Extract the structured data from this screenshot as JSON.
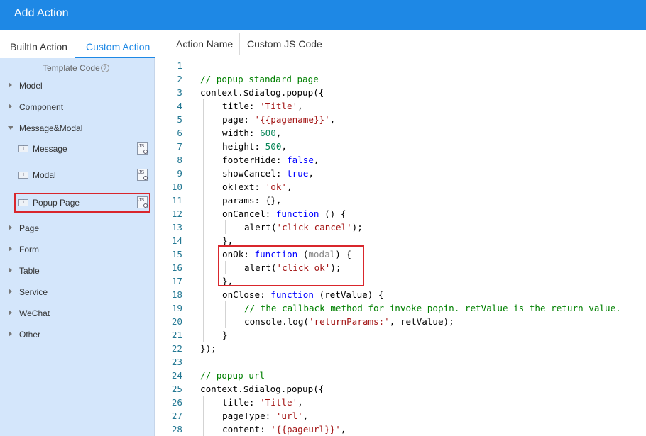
{
  "window": {
    "title": "Add Action"
  },
  "sidebar": {
    "tabs": [
      {
        "label": "BuiltIn Action",
        "active": false
      },
      {
        "label": "Custom Action",
        "active": true
      }
    ],
    "template_label": "Template Code",
    "tree": [
      {
        "label": "Model",
        "expanded": false
      },
      {
        "label": "Component",
        "expanded": false
      },
      {
        "label": "Message&Modal",
        "expanded": true,
        "children": [
          {
            "label": "Message"
          },
          {
            "label": "Modal"
          },
          {
            "label": "Popup Page",
            "selected": true
          }
        ]
      },
      {
        "label": "Page",
        "expanded": false
      },
      {
        "label": "Form",
        "expanded": false
      },
      {
        "label": "Table",
        "expanded": false
      },
      {
        "label": "Service",
        "expanded": false
      },
      {
        "label": "WeChat",
        "expanded": false
      },
      {
        "label": "Other",
        "expanded": false
      }
    ]
  },
  "main": {
    "action_name_label": "Action Name",
    "action_name_value": "Custom JS Code"
  },
  "code_lines": [
    {
      "n": 1,
      "indent": 0,
      "parts": []
    },
    {
      "n": 2,
      "indent": 0,
      "parts": [
        [
          "cm",
          "// popup standard page"
        ]
      ]
    },
    {
      "n": 3,
      "indent": 0,
      "parts": [
        [
          "",
          "context.$dialog.popup({"
        ]
      ]
    },
    {
      "n": 4,
      "indent": 1,
      "parts": [
        [
          "",
          "title: "
        ],
        [
          "str",
          "'Title'"
        ],
        [
          "",
          ","
        ]
      ]
    },
    {
      "n": 5,
      "indent": 1,
      "parts": [
        [
          "",
          "page: "
        ],
        [
          "str",
          "'{{pagename}}'"
        ],
        [
          "",
          ","
        ]
      ]
    },
    {
      "n": 6,
      "indent": 1,
      "parts": [
        [
          "",
          "width: "
        ],
        [
          "num",
          "600"
        ],
        [
          "",
          ","
        ]
      ]
    },
    {
      "n": 7,
      "indent": 1,
      "parts": [
        [
          "",
          "height: "
        ],
        [
          "num",
          "500"
        ],
        [
          "",
          ","
        ]
      ]
    },
    {
      "n": 8,
      "indent": 1,
      "parts": [
        [
          "",
          "footerHide: "
        ],
        [
          "kw",
          "false"
        ],
        [
          "",
          ","
        ]
      ]
    },
    {
      "n": 9,
      "indent": 1,
      "parts": [
        [
          "",
          "showCancel: "
        ],
        [
          "kw",
          "true"
        ],
        [
          "",
          ","
        ]
      ]
    },
    {
      "n": 10,
      "indent": 1,
      "parts": [
        [
          "",
          "okText: "
        ],
        [
          "str",
          "'ok'"
        ],
        [
          "",
          ","
        ]
      ]
    },
    {
      "n": 11,
      "indent": 1,
      "parts": [
        [
          "",
          "params: {},"
        ]
      ]
    },
    {
      "n": 12,
      "indent": 1,
      "parts": [
        [
          "",
          "onCancel: "
        ],
        [
          "kw",
          "function"
        ],
        [
          "",
          " () {"
        ]
      ]
    },
    {
      "n": 13,
      "indent": 2,
      "parts": [
        [
          "",
          "alert("
        ],
        [
          "str",
          "'click cancel'"
        ],
        [
          "",
          ");"
        ]
      ]
    },
    {
      "n": 14,
      "indent": 1,
      "parts": [
        [
          "",
          "},"
        ]
      ]
    },
    {
      "n": 15,
      "indent": 1,
      "parts": [
        [
          "",
          "onOk: "
        ],
        [
          "kw",
          "function"
        ],
        [
          "",
          " ("
        ],
        [
          "prm",
          "modal"
        ],
        [
          "",
          ") {"
        ]
      ]
    },
    {
      "n": 16,
      "indent": 2,
      "parts": [
        [
          "",
          "alert("
        ],
        [
          "str",
          "'click ok'"
        ],
        [
          "",
          ");"
        ]
      ]
    },
    {
      "n": 17,
      "indent": 1,
      "parts": [
        [
          "",
          "},"
        ]
      ]
    },
    {
      "n": 18,
      "indent": 1,
      "parts": [
        [
          "",
          "onClose: "
        ],
        [
          "kw",
          "function"
        ],
        [
          "",
          " (retValue) {"
        ]
      ]
    },
    {
      "n": 19,
      "indent": 2,
      "parts": [
        [
          "cm",
          "// the callback method for invoke popin. retValue is the return value."
        ]
      ]
    },
    {
      "n": 20,
      "indent": 2,
      "parts": [
        [
          "",
          "console.log("
        ],
        [
          "str",
          "'returnParams:'"
        ],
        [
          "",
          ", retValue);"
        ]
      ]
    },
    {
      "n": 21,
      "indent": 1,
      "parts": [
        [
          "",
          "}"
        ]
      ]
    },
    {
      "n": 22,
      "indent": 0,
      "parts": [
        [
          "",
          "});"
        ]
      ]
    },
    {
      "n": 23,
      "indent": 0,
      "parts": []
    },
    {
      "n": 24,
      "indent": 0,
      "parts": [
        [
          "cm",
          "// popup url"
        ]
      ]
    },
    {
      "n": 25,
      "indent": 0,
      "parts": [
        [
          "",
          "context.$dialog.popup({"
        ]
      ]
    },
    {
      "n": 26,
      "indent": 1,
      "parts": [
        [
          "",
          "title: "
        ],
        [
          "str",
          "'Title'"
        ],
        [
          "",
          ","
        ]
      ]
    },
    {
      "n": 27,
      "indent": 1,
      "parts": [
        [
          "",
          "pageType: "
        ],
        [
          "str",
          "'url'"
        ],
        [
          "",
          ","
        ]
      ]
    },
    {
      "n": 28,
      "indent": 1,
      "parts": [
        [
          "",
          "content: "
        ],
        [
          "str",
          "'{{pageurl}}'"
        ],
        [
          "",
          ","
        ]
      ]
    }
  ],
  "colors": {
    "accent": "#1e88e5",
    "sidebar_bg": "#d4e6fb",
    "highlight_box": "#d9262c"
  }
}
